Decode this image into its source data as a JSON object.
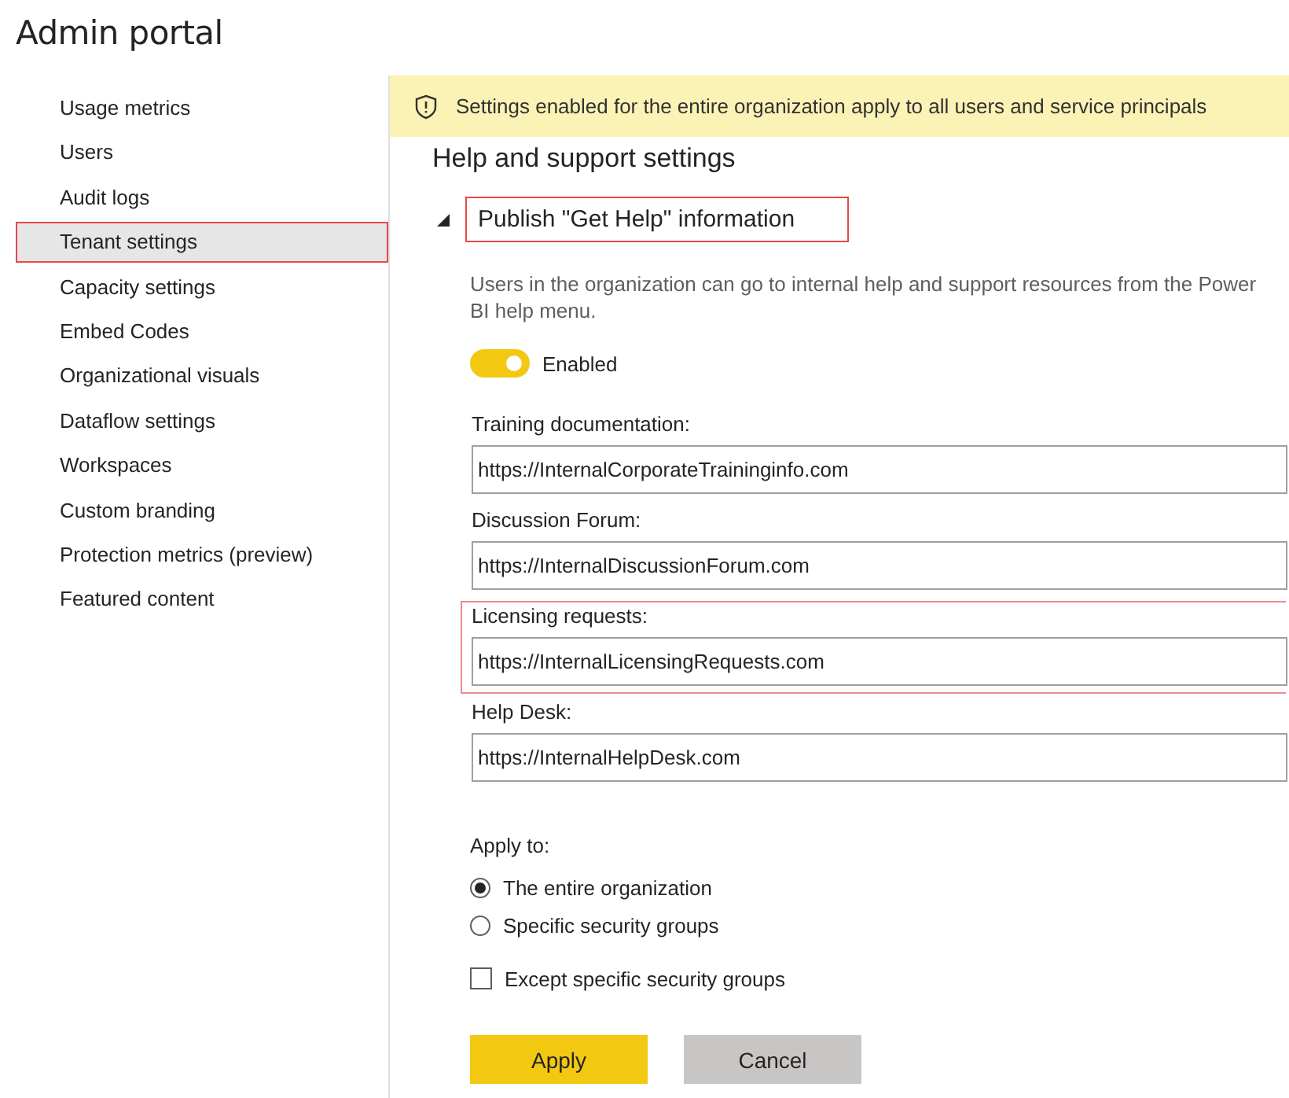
{
  "page_title": "Admin portal",
  "sidebar": {
    "items": [
      {
        "label": "Usage metrics",
        "selected": false,
        "highlighted": false
      },
      {
        "label": "Users",
        "selected": false,
        "highlighted": false
      },
      {
        "label": "Audit logs",
        "selected": false,
        "highlighted": false
      },
      {
        "label": "Tenant settings",
        "selected": true,
        "highlighted": true
      },
      {
        "label": "Capacity settings",
        "selected": false,
        "highlighted": false
      },
      {
        "label": "Embed Codes",
        "selected": false,
        "highlighted": false
      },
      {
        "label": "Organizational visuals",
        "selected": false,
        "highlighted": false
      },
      {
        "label": "Dataflow settings",
        "selected": false,
        "highlighted": false
      },
      {
        "label": "Workspaces",
        "selected": false,
        "highlighted": false
      },
      {
        "label": "Custom branding",
        "selected": false,
        "highlighted": false
      },
      {
        "label": "Protection metrics (preview)",
        "selected": false,
        "highlighted": false
      },
      {
        "label": "Featured content",
        "selected": false,
        "highlighted": false
      }
    ]
  },
  "banner": {
    "text": "Settings enabled for the entire organization apply to all users and service principals"
  },
  "section_title": "Help and support settings",
  "setting": {
    "title": "Publish \"Get Help\" information",
    "expanded": true,
    "highlighted": true,
    "description": "Users in the organization can go to internal help and support resources from the Power BI help menu.",
    "toggle": {
      "label": "Enabled",
      "on": true
    },
    "fields": [
      {
        "label": "Training documentation:",
        "value": "https://InternalCorporateTraininginfo.com",
        "highlighted": false
      },
      {
        "label": "Discussion Forum:",
        "value": "https://InternalDiscussionForum.com",
        "highlighted": false
      },
      {
        "label": "Licensing requests:",
        "value": "https://InternalLicensingRequests.com",
        "highlighted": true
      },
      {
        "label": "Help Desk:",
        "value": "https://InternalHelpDesk.com",
        "highlighted": false
      }
    ],
    "apply_to": {
      "label": "Apply to:",
      "options": [
        {
          "label": "The entire organization",
          "selected": true
        },
        {
          "label": "Specific security groups",
          "selected": false
        }
      ]
    },
    "except": {
      "label": "Except specific security groups",
      "checked": false
    },
    "buttons": [
      {
        "label": "Apply",
        "kind": "primary"
      },
      {
        "label": "Cancel",
        "kind": "secondary"
      }
    ]
  }
}
